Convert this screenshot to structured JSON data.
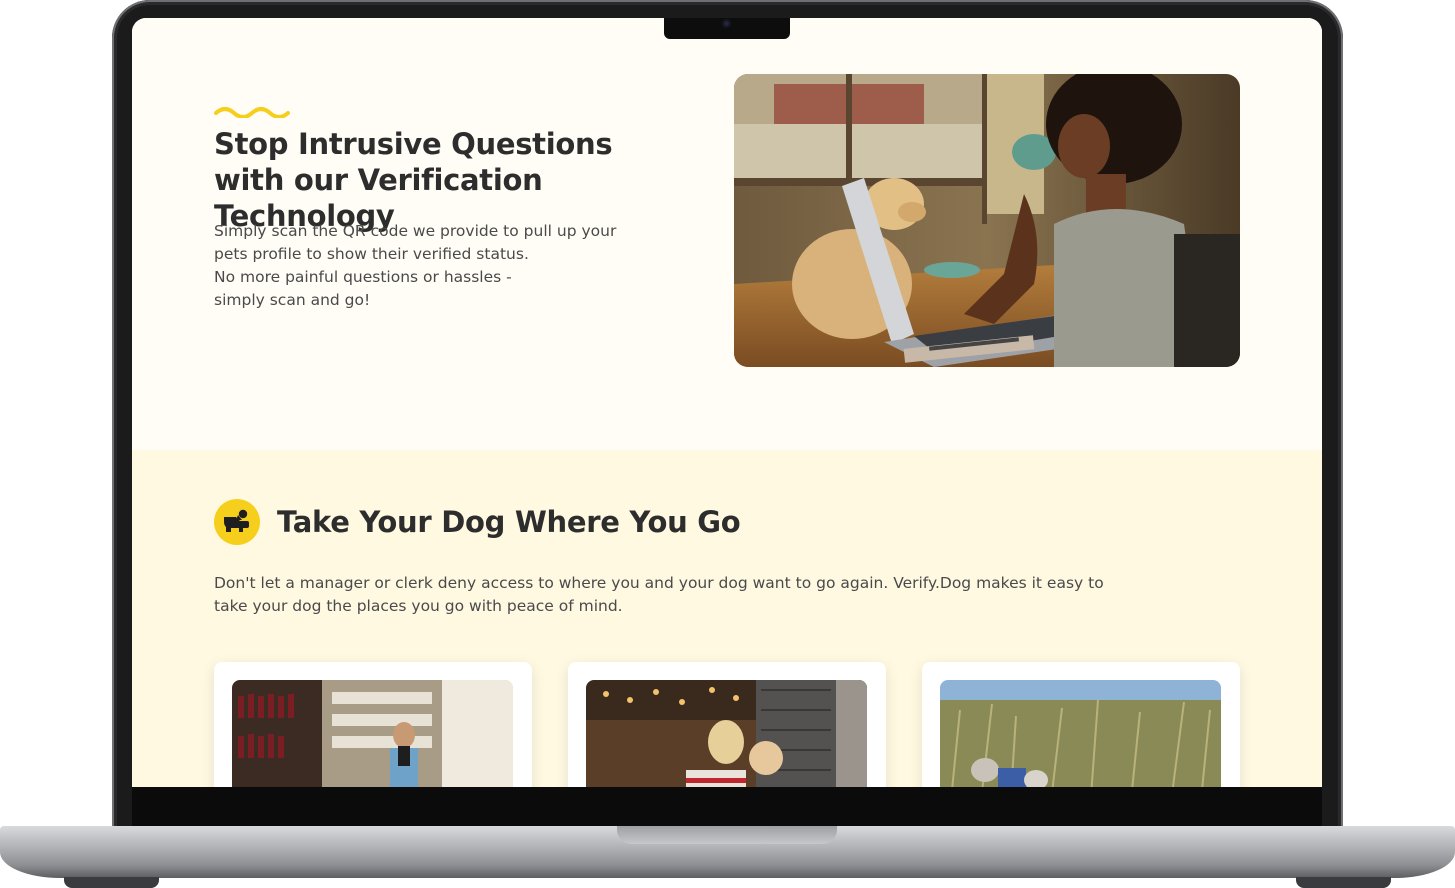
{
  "hero": {
    "title": "Stop Intrusive Questions with our Verification Technology",
    "intro_lines": [
      "Simply scan the QR code we provide to pull up your",
      "pets profile to show their verified status.",
      "No more painful questions or hassles -",
      "simply scan and go!"
    ],
    "image_alt": "Woman sipping coffee at laptop with golden retriever beside her"
  },
  "feature": {
    "title": "Take Your Dog Where You Go",
    "description": "Don't let a manager or clerk deny access to where you and your dog want to go again. Verify.Dog makes it easy to take your dog the places you go with peace of mind.",
    "icon": "dog-icon",
    "cards": [
      {
        "image_alt": "Woman with dog shopping in a wine store"
      },
      {
        "image_alt": "Woman with dog in a restaurant"
      },
      {
        "image_alt": "Person with dog in tall beach grass"
      }
    ]
  },
  "colors": {
    "accent": "#f6cf1c",
    "page_bg": "#fffdf6",
    "section_bg": "#fff9e2",
    "heading": "#2d2d2d",
    "body_text": "#4a4a4a"
  }
}
